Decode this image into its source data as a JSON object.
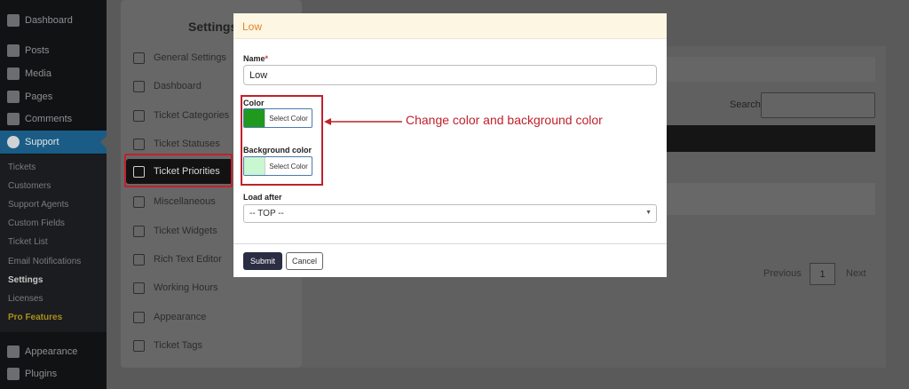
{
  "wp_menu": {
    "items": [
      {
        "label": "Dashboard",
        "icon": "dashboard-icon"
      },
      {
        "label": "Posts",
        "icon": "pin-icon"
      },
      {
        "label": "Media",
        "icon": "media-icon"
      },
      {
        "label": "Pages",
        "icon": "pages-icon"
      },
      {
        "label": "Comments",
        "icon": "comments-icon"
      },
      {
        "label": "Support",
        "icon": "support-icon"
      }
    ],
    "submenu": [
      "Tickets",
      "Customers",
      "Support Agents",
      "Custom Fields",
      "Ticket List",
      "Email Notifications",
      "Settings",
      "Licenses",
      "Pro Features"
    ],
    "bottom_items": [
      {
        "label": "Appearance",
        "icon": "brush-icon"
      },
      {
        "label": "Plugins",
        "icon": "plugin-icon"
      }
    ]
  },
  "settings": {
    "title": "Settings",
    "items": [
      "General Settings",
      "Dashboard",
      "Ticket Categories",
      "Ticket Statuses",
      "Ticket Priorities",
      "Miscellaneous",
      "Ticket Widgets",
      "Rich Text Editor",
      "Working Hours",
      "Appearance",
      "Ticket Tags"
    ]
  },
  "background": {
    "search_label": "Search:",
    "pagination": {
      "previous": "Previous",
      "page": "1",
      "next": "Next"
    }
  },
  "modal": {
    "title": "Low",
    "name_label": "Name",
    "required_mark": "*",
    "name_value": "Low",
    "color_label": "Color",
    "color_value": "#1f9a1f",
    "select_color": "Select Color",
    "background_color_label": "Background color",
    "background_color_value": "#c9f7d2",
    "load_after_label": "Load after",
    "load_after_value": "-- TOP --",
    "submit": "Submit",
    "cancel": "Cancel"
  },
  "annotation": {
    "text": "Change color and background color",
    "color": "#c0212c"
  }
}
